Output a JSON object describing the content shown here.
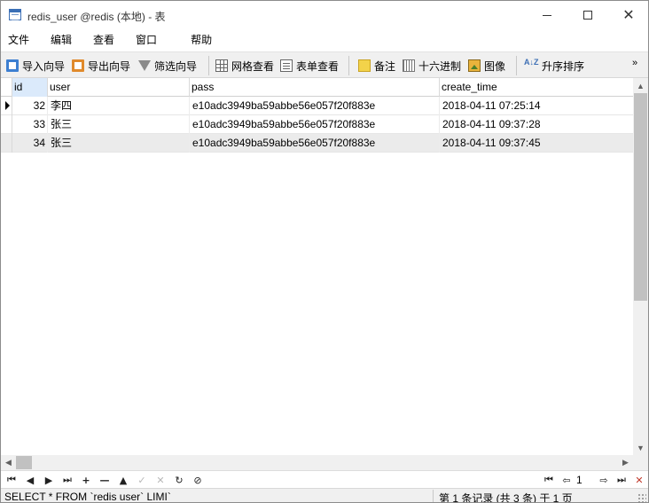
{
  "window": {
    "title": "redis_user @redis (本地) - 表",
    "controls": {
      "minimize": "—",
      "maximize": "☐",
      "close": "✕"
    }
  },
  "menu": {
    "file": "文件",
    "edit": "编辑",
    "view": "查看",
    "window": "窗口",
    "help": "帮助"
  },
  "toolbar": {
    "import_wizard": "导入向导",
    "export_wizard": "导出向导",
    "filter_wizard": "筛选向导",
    "grid_view": "网格查看",
    "form_view": "表单查看",
    "memo": "备注",
    "hex": "十六进制",
    "image": "图像",
    "sort_asc": "升序排序",
    "more": "»",
    "sort_icon_text": "A↓Z"
  },
  "grid": {
    "columns": [
      "id",
      "user",
      "pass",
      "create_time"
    ],
    "rows": [
      {
        "id": "32",
        "user": "李四",
        "pass": "e10adc3949ba59abbe56e057f20f883e",
        "create_time": "2018-04-11 07:25:14"
      },
      {
        "id": "33",
        "user": "张三",
        "pass": "e10adc3949ba59abbe56e057f20f883e",
        "create_time": "2018-04-11 09:37:28"
      },
      {
        "id": "34",
        "user": "张三",
        "pass": "e10adc3949ba59abbe56e057f20f883e",
        "create_time": "2018-04-11 09:37:45"
      }
    ],
    "current_row": 0,
    "selected_row": 2
  },
  "scrollbars": {
    "up": "▲",
    "down": "▼",
    "left": "◀",
    "right": "▶"
  },
  "navigator": {
    "first": "⏮",
    "prev": "◀",
    "next": "▶",
    "last": "⏭",
    "add": "+",
    "delete": "—",
    "up": "▲",
    "apply": "✓",
    "cancel": "✕",
    "refresh": "↻",
    "stop": "⊘",
    "page_first": "⏮",
    "page_prev": "⇦",
    "page": "1",
    "page_next": "⇨",
    "page_last": "⏭",
    "settings": "✕"
  },
  "status": {
    "sql": "SELECT * FROM `redis user` LIMI`",
    "records": "第 1 条记录 (共 3 条) 于 1 页"
  }
}
